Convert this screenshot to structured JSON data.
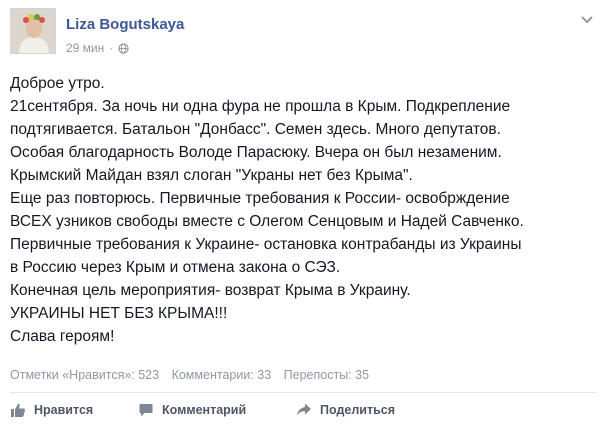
{
  "post": {
    "author": "Liza Bogutskaya",
    "time": "29 мин",
    "separator": "·",
    "audience_icon": "globe-icon",
    "menu_icon": "chevron-down-icon",
    "lines": [
      "Доброе утро.",
      "21сентября. За ночь ни одна фура не прошла в Крым. Подкрепление",
      "подтягивается. Батальон \"Донбасс\". Семен здесь. Много депутатов.",
      "Особая благодарность Володе Парасюку. Вчера он был незаменим.",
      "Крымский Майдан взял слоган \"Украны нет без Крыма\".",
      "Еще раз повторюсь. Первичные требования к России- освобрждение",
      "ВСЕХ узников свободы вместе с Олегом Сенцовым и Надей Савченко.",
      "Первичные требования к Украине- остановка контрабанды из Украины",
      "в Россию через Крым и отмена закона о СЭЗ.",
      "Конечная цель мероприятия- возврат Крыма в Украину.",
      "УКРАИНЫ НЕТ БЕЗ КРЫМА!!!",
      "Слава героям!"
    ]
  },
  "stats": {
    "likes": "Отметки «Нравится»: 523",
    "comments": "Комментарии: 33",
    "shares": "Перепосты: 35"
  },
  "actions": {
    "like": {
      "label": "Нравится",
      "icon": "thumbs-up-icon"
    },
    "comment": {
      "label": "Комментарий",
      "icon": "comment-icon"
    },
    "share": {
      "label": "Поделиться",
      "icon": "share-icon"
    }
  },
  "colors": {
    "link": "#3b5998",
    "text": "#141823",
    "muted": "#9197a3",
    "action": "#4e5665"
  }
}
